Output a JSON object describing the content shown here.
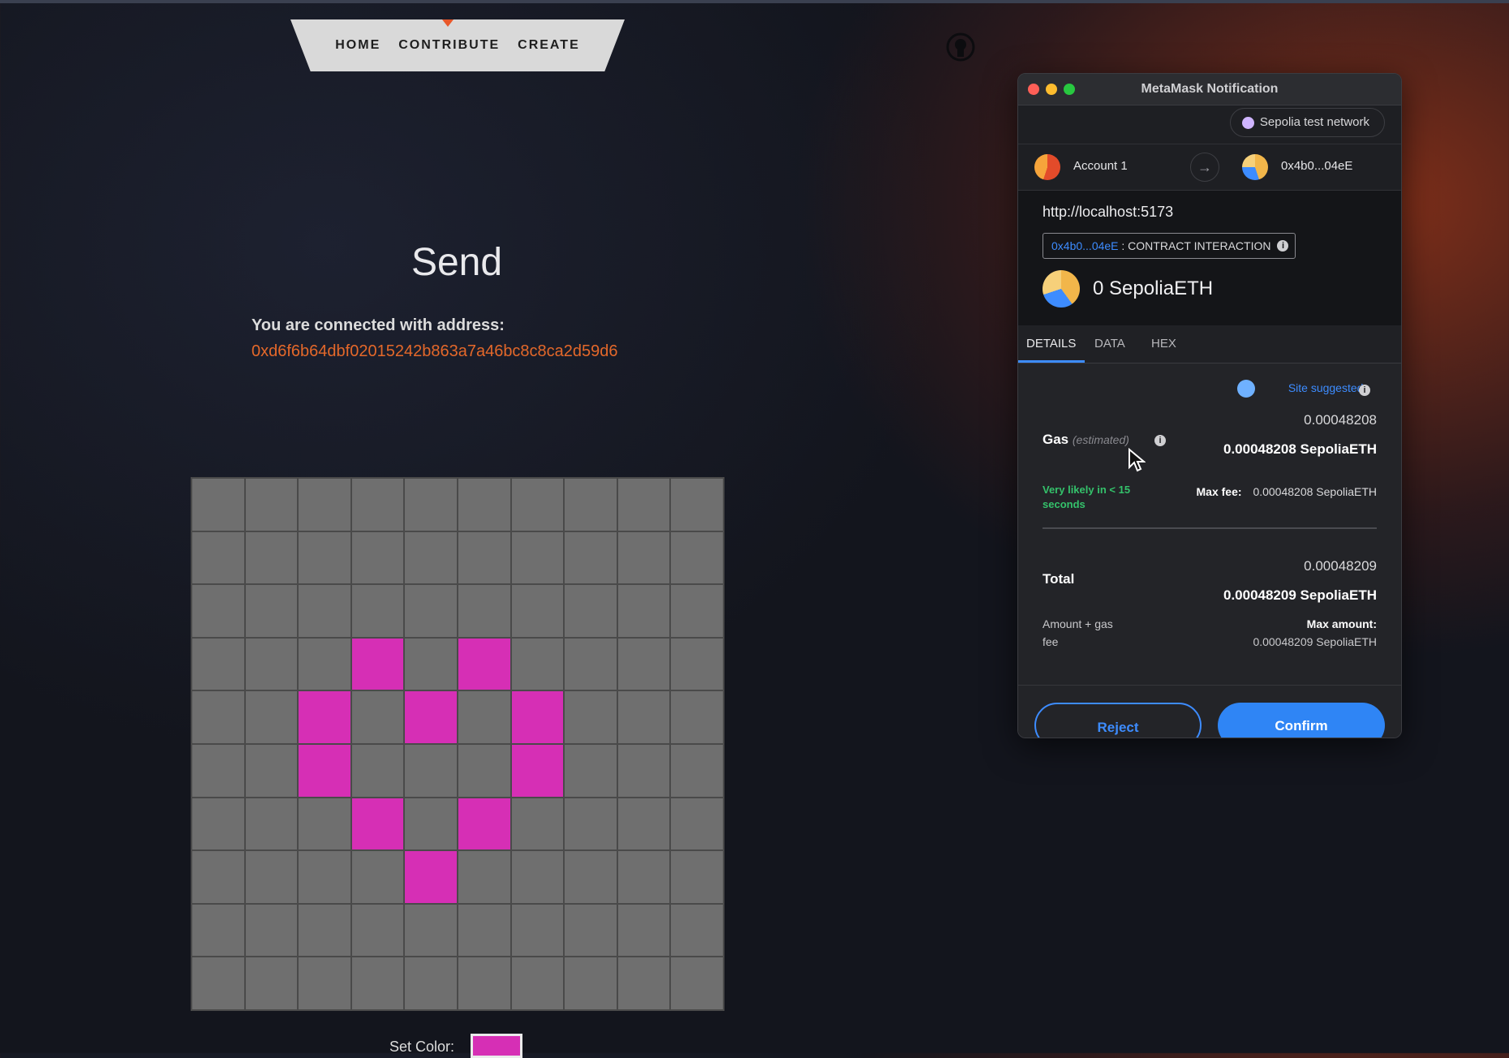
{
  "nav": {
    "home": "HOME",
    "contribute": "CONTRIBUTE",
    "create": "CREATE"
  },
  "page": {
    "title": "Send",
    "connected_label": "You are connected with address:",
    "connected_address": "0xd6f6b64dbf02015242b863a7a46bc8c8ca2d59d6",
    "set_color_label": "Set Color:",
    "selected_color": "#d62fb5"
  },
  "pixel_grid": {
    "rows": 10,
    "cols": 10,
    "empty_color": "#6f6f6f",
    "fill_color": "#d62fb5",
    "filled_cells": [
      [
        3,
        3
      ],
      [
        3,
        5
      ],
      [
        4,
        2
      ],
      [
        4,
        4
      ],
      [
        4,
        6
      ],
      [
        5,
        2
      ],
      [
        5,
        6
      ],
      [
        6,
        3
      ],
      [
        6,
        5
      ],
      [
        7,
        4
      ]
    ]
  },
  "metamask": {
    "window_title": "MetaMask Notification",
    "network": "Sepolia test network",
    "from_account": "Account 1",
    "to_address": "0x4b0...04eE",
    "origin": "http://localhost:5173",
    "contract_address": "0x4b0...04eE",
    "contract_label": ": CONTRACT INTERACTION",
    "amount": "0 SepoliaETH",
    "tabs": [
      "DETAILS",
      "DATA",
      "HEX"
    ],
    "site_suggested": "Site suggested",
    "gas_label": "Gas",
    "gas_estimated": "(estimated)",
    "gas_value": "0.00048208",
    "gas_value_eth": "0.00048208 SepoliaETH",
    "likely_text": "Very likely in < 15 seconds",
    "max_fee_label": "Max fee:",
    "max_fee_value": "0.00048208 SepoliaETH",
    "total_label": "Total",
    "total_value": "0.00048209",
    "total_value_eth": "0.00048209 SepoliaETH",
    "amount_gas_fee": "Amount + gas fee",
    "max_amount_label": "Max amount:",
    "max_amount_value": "0.00048209 SepoliaETH",
    "reject": "Reject",
    "confirm": "Confirm",
    "colors": {
      "accent_blue": "#3d8cff",
      "likely_green": "#34c26b"
    }
  }
}
